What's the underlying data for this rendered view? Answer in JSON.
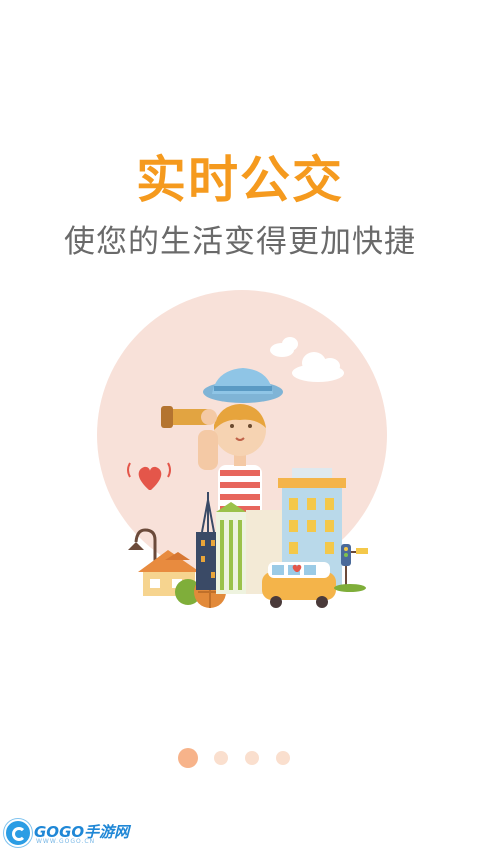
{
  "header": {
    "title": "实时公交",
    "subtitle": "使您的生活变得更加快捷"
  },
  "pager": {
    "total": 4,
    "active_index": 0
  },
  "watermark": {
    "brand": "GOGO手游网",
    "url": "WWW.GOGO.CN"
  },
  "colors": {
    "accent": "#f59a1e",
    "subtitle": "#6a6a6a",
    "circle": "#f8e1d9",
    "dot_active": "#f7b38a",
    "dot_inactive": "#fadfce"
  }
}
